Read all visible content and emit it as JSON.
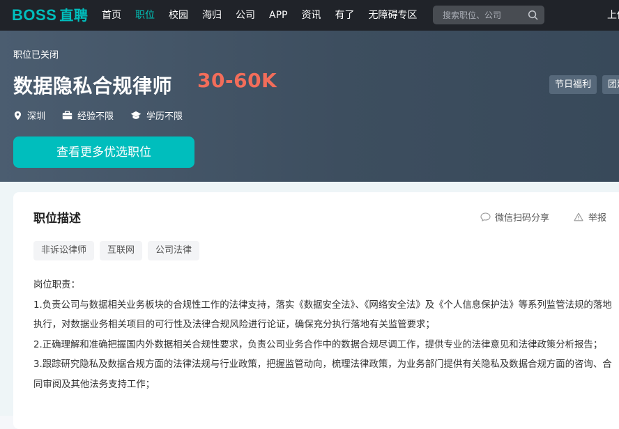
{
  "nav": {
    "logo_en": "BOSS",
    "logo_cn": "直聘",
    "items": [
      {
        "label": "首页",
        "active": false
      },
      {
        "label": "职位",
        "active": true
      },
      {
        "label": "校园",
        "active": false
      },
      {
        "label": "海归",
        "active": false
      },
      {
        "label": "公司",
        "active": false
      },
      {
        "label": "APP",
        "active": false
      },
      {
        "label": "资讯",
        "active": false
      },
      {
        "label": "有了",
        "active": false
      },
      {
        "label": "无障碍专区",
        "active": false
      }
    ],
    "search_placeholder": "搜索职位、公司",
    "right_text": "上传"
  },
  "job": {
    "status": "职位已关闭",
    "title": "数据隐私合规律师",
    "salary": "30-60K",
    "benefits": [
      "节日福利",
      "团建聚餐"
    ],
    "city": "深圳",
    "experience": "经验不限",
    "education": "学历不限",
    "cta_label": "查看更多优选职位"
  },
  "description": {
    "title": "职位描述",
    "share_label": "微信扫码分享",
    "report_label": "举报",
    "tags": [
      "非诉讼律师",
      "互联网",
      "公司法律"
    ],
    "lines": [
      "岗位职责：",
      "1.负责公司与数据相关业务板块的合规性工作的法律支持，落实《数据安全法》、《网络安全法》及《个人信息保护法》等系列监管法规的落地执行，对数据业务相关项目的可行性及法律合规风险进行论证，确保充分执行落地有关监管要求；",
      "2.正确理解和准确把握国内外数据相关合规性要求，负责公司业务合作中的数据合规尽调工作，提供专业的法律意见和法律政策分析报告；",
      "3.跟踪研究隐私及数据合规方面的法律法规与行业政策，把握监管动向，梳理法律政策，为业务部门提供有关隐私及数据合规方面的咨询、合同审阅及其他法务支持工作；"
    ]
  },
  "colors": {
    "accent": "#00bebd",
    "salary": "#f26d5a",
    "topbar": "#202329",
    "banner": "#445566"
  }
}
